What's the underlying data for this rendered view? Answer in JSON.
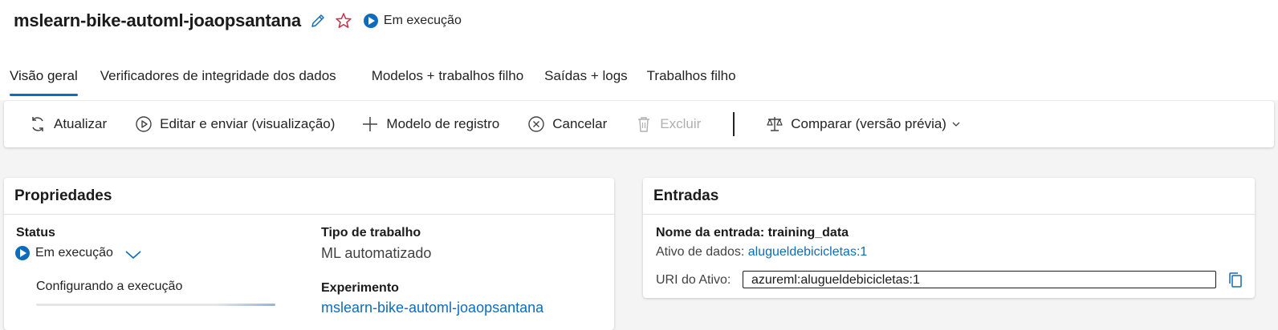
{
  "header": {
    "title": "mslearn-bike-automl-joaopsantana",
    "status": "Em execução"
  },
  "tabs": [
    {
      "label": "Visão geral",
      "active": true
    },
    {
      "label": "Verificadores de integridade dos dados",
      "active": false
    },
    {
      "label": "Modelos + trabalhos filho",
      "active": false
    },
    {
      "label": "Saídas + logs",
      "active": false
    },
    {
      "label": "Trabalhos filho",
      "active": false
    }
  ],
  "toolbar": {
    "refresh": "Atualizar",
    "edit_submit": "Editar e enviar (visualização)",
    "register_model": "Modelo de registro",
    "cancel": "Cancelar",
    "delete": "Excluir",
    "compare": "Comparar (versão prévia)"
  },
  "properties": {
    "heading": "Propriedades",
    "status_label": "Status",
    "status_value": "Em execução",
    "status_detail": "Configurando a execução",
    "job_type_label": "Tipo de trabalho",
    "job_type_value": "ML automatizado",
    "experiment_label": "Experimento",
    "experiment_value": "mslearn-bike-automl-joaopsantana"
  },
  "inputs": {
    "heading": "Entradas",
    "input_name_label": "Nome da entrada: training_data",
    "data_asset_label": "Ativo de dados:",
    "data_asset_value": "alugueldebicicletas:1",
    "uri_label": "URI do Ativo:",
    "uri_value": "azureml:alugueldebicicletas:1"
  },
  "colors": {
    "accent": "#0f6cbd",
    "favorite_star": "#c4314b",
    "disabled_text": "#b0b0b0",
    "page_background": "#f4f4f4"
  },
  "icons": [
    "edit-pencil-icon",
    "favorite-star-icon",
    "running-play-icon",
    "refresh-icon",
    "play-circle-icon",
    "plus-icon",
    "cancel-circle-icon",
    "trash-icon",
    "compare-scale-icon",
    "chevron-down-icon",
    "copy-icon"
  ]
}
